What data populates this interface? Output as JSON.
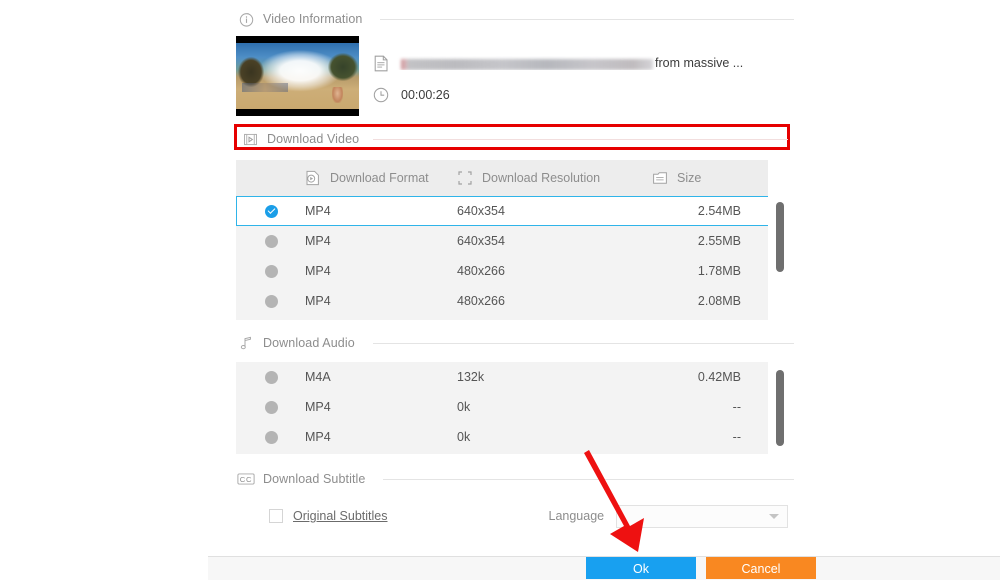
{
  "video_information": {
    "section_label": "Video Information",
    "section_icon": "info-circle-icon",
    "thumbnail_icon": "video-thumbnail",
    "title_icon": "document-icon",
    "title_prefix": "",
    "title_redacted": true,
    "title_suffix": "from massive ...",
    "duration_icon": "clock-icon",
    "duration": "00:00:26"
  },
  "download_video": {
    "section_label": "Download Video",
    "section_icon": "film-strip-icon",
    "highlight_color": "#e60000",
    "columns": [
      {
        "label": "Download Format",
        "icon": "video-file-icon"
      },
      {
        "label": "Download Resolution",
        "icon": "crop-frame-icon"
      },
      {
        "label": "Size",
        "icon": "file-lines-icon"
      }
    ],
    "rows": [
      {
        "selected": true,
        "format": "MP4",
        "resolution": "640x354",
        "size": "2.54MB"
      },
      {
        "selected": false,
        "format": "MP4",
        "resolution": "640x354",
        "size": "2.55MB"
      },
      {
        "selected": false,
        "format": "MP4",
        "resolution": "480x266",
        "size": "1.78MB"
      },
      {
        "selected": false,
        "format": "MP4",
        "resolution": "480x266",
        "size": "2.08MB"
      }
    ]
  },
  "download_audio": {
    "section_label": "Download Audio",
    "section_icon": "music-note-icon",
    "rows": [
      {
        "selected": false,
        "format": "M4A",
        "bitrate": "132k",
        "size": "0.42MB"
      },
      {
        "selected": false,
        "format": "MP4",
        "bitrate": "0k",
        "size": "--"
      },
      {
        "selected": false,
        "format": "MP4",
        "bitrate": "0k",
        "size": "--"
      }
    ]
  },
  "download_subtitle": {
    "section_label": "Download Subtitle",
    "section_icon": "closed-caption-icon",
    "original_subtitles_label": "Original Subtitles",
    "original_subtitles_checked": false,
    "language_label": "Language",
    "language_value": "",
    "language_placeholder": ""
  },
  "footer": {
    "ok_label": "Ok",
    "cancel_label": "Cancel",
    "ok_color": "#18a0f0",
    "cancel_color": "#f98821"
  },
  "annotation": {
    "arrow_color": "#ee1111",
    "arrow_target": "ok-button"
  }
}
